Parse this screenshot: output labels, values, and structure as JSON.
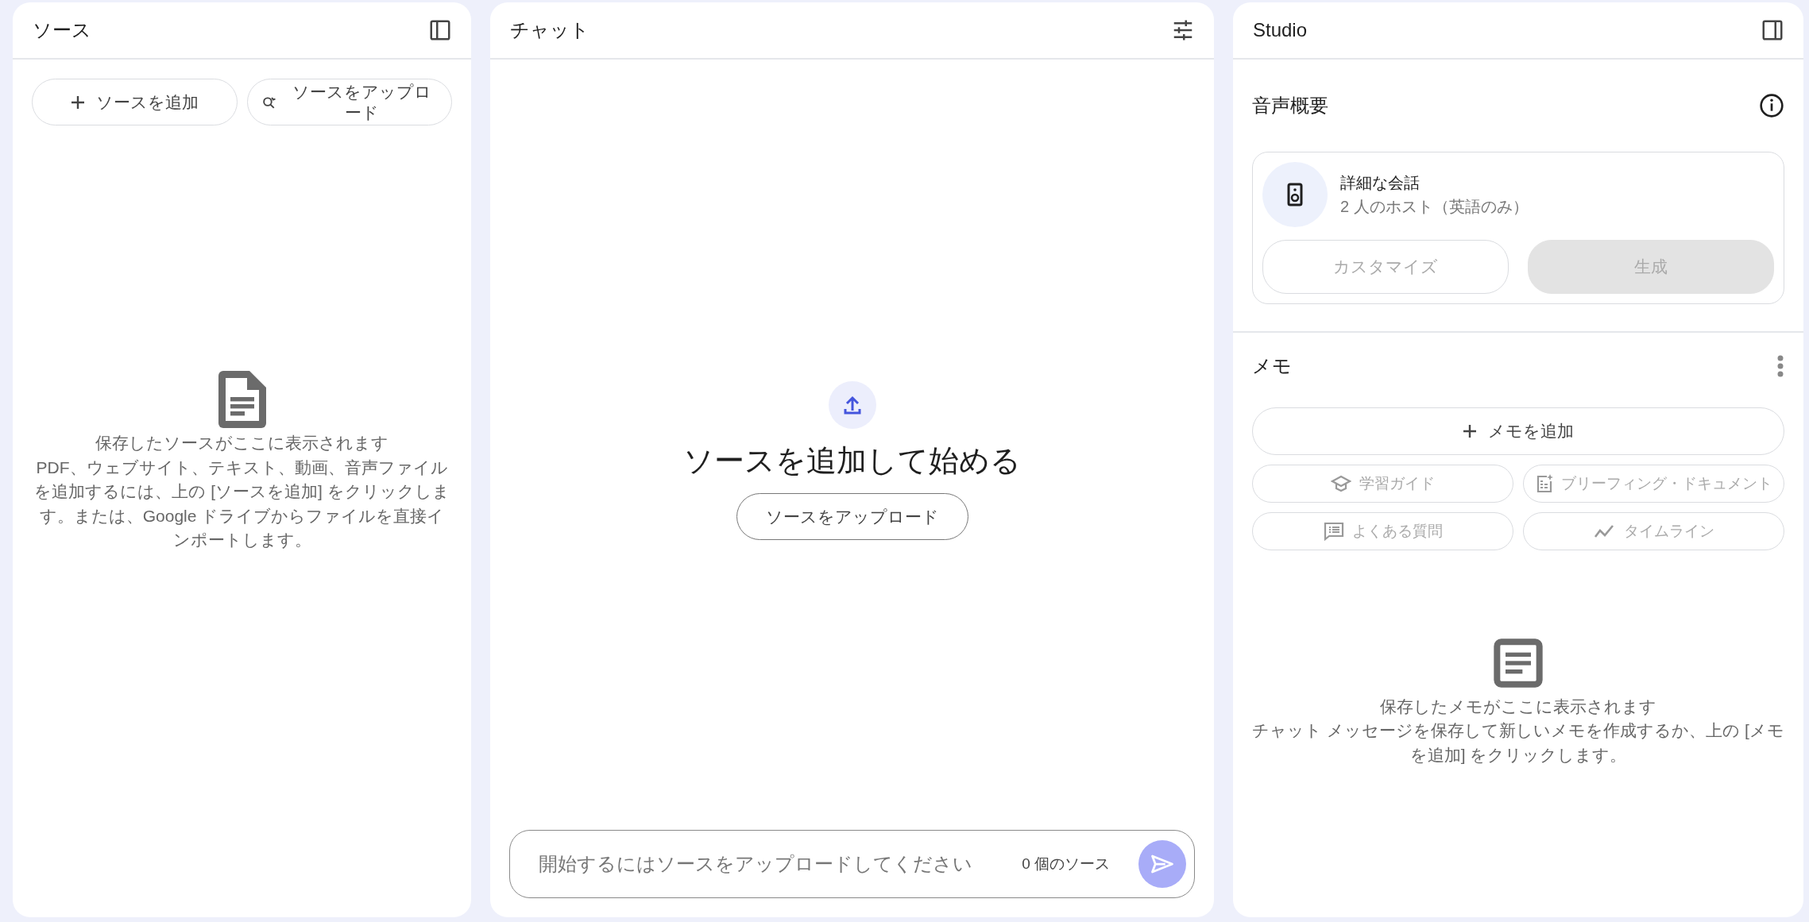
{
  "sources": {
    "title": "ソース",
    "buttons": [
      {
        "kind": "add",
        "label": "ソースを追加"
      },
      {
        "kind": "discover",
        "label": "ソースをアップロード"
      }
    ],
    "empty": {
      "heading": "保存したソースがここに表示されます",
      "text": "PDF、ウェブサイト、テキスト、動画、音声ファイルを追加するには、上の [ソースを追加] をクリックします。または、Google ドライブからファイルを直接インポートします。"
    }
  },
  "chat": {
    "title": "チャット",
    "heading": "ソースを追加して始める",
    "upload_button": "ソースをアップロード",
    "input": {
      "placeholder": "開始するにはソースをアップロードしてください"
    },
    "source_count": "0 個のソース",
    "send_disabled": true
  },
  "studio": {
    "title": "Studio",
    "audio": {
      "title": "音声概要",
      "card_title": "詳細な会話",
      "card_subtitle": "2 人のホスト（英語のみ）",
      "buttons": [
        {
          "kind": "outline",
          "label": "カスタマイズ",
          "disabled": true
        },
        {
          "kind": "filled",
          "label": "生成",
          "disabled": true
        }
      ]
    },
    "notes": {
      "title": "メモ",
      "add_button": "メモを追加",
      "actions": [
        {
          "kind": "study",
          "label": "学習ガイド",
          "disabled": true
        },
        {
          "kind": "briefing",
          "label": "ブリーフィング・ドキュメント",
          "disabled": true
        },
        {
          "kind": "faq",
          "label": "よくある質問",
          "disabled": true
        },
        {
          "kind": "timeline",
          "label": "タイムライン",
          "disabled": true
        }
      ],
      "empty": {
        "heading": "保存したメモがここに表示されます",
        "text": "チャット メッセージを保存して新しいメモを作成するか、上の [メモを追加] をクリックします。"
      }
    }
  }
}
